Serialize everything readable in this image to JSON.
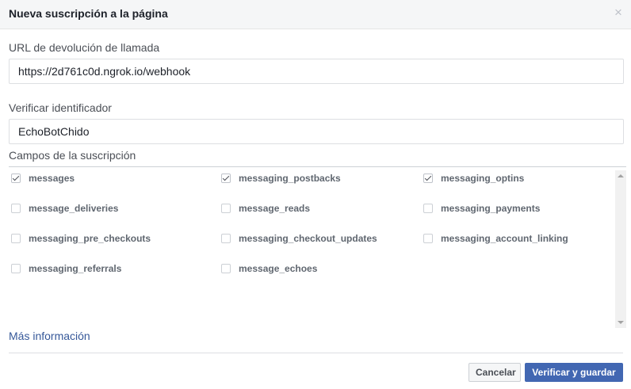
{
  "dialog": {
    "title": "Nueva suscripción a la página",
    "close_glyph": "×"
  },
  "callback_url": {
    "label": "URL de devolución de llamada",
    "value": "https://2d761c0d.ngrok.io/webhook"
  },
  "verify_token": {
    "label": "Verificar identificador",
    "value": "EchoBotChido"
  },
  "subscription_fields": {
    "label": "Campos de la suscripción",
    "items": [
      {
        "name": "messages",
        "checked": true
      },
      {
        "name": "messaging_postbacks",
        "checked": true
      },
      {
        "name": "messaging_optins",
        "checked": true
      },
      {
        "name": "message_deliveries",
        "checked": false
      },
      {
        "name": "message_reads",
        "checked": false
      },
      {
        "name": "messaging_payments",
        "checked": false
      },
      {
        "name": "messaging_pre_checkouts",
        "checked": false
      },
      {
        "name": "messaging_checkout_updates",
        "checked": false
      },
      {
        "name": "messaging_account_linking",
        "checked": false
      },
      {
        "name": "messaging_referrals",
        "checked": false
      },
      {
        "name": "message_echoes",
        "checked": false
      }
    ]
  },
  "more_info_link": "Más información",
  "footer": {
    "cancel_label": "Cancelar",
    "submit_label": "Verificar y guardar"
  },
  "colors": {
    "primary_button": "#4267b2",
    "link": "#365899",
    "header_background": "#f5f6f7"
  }
}
